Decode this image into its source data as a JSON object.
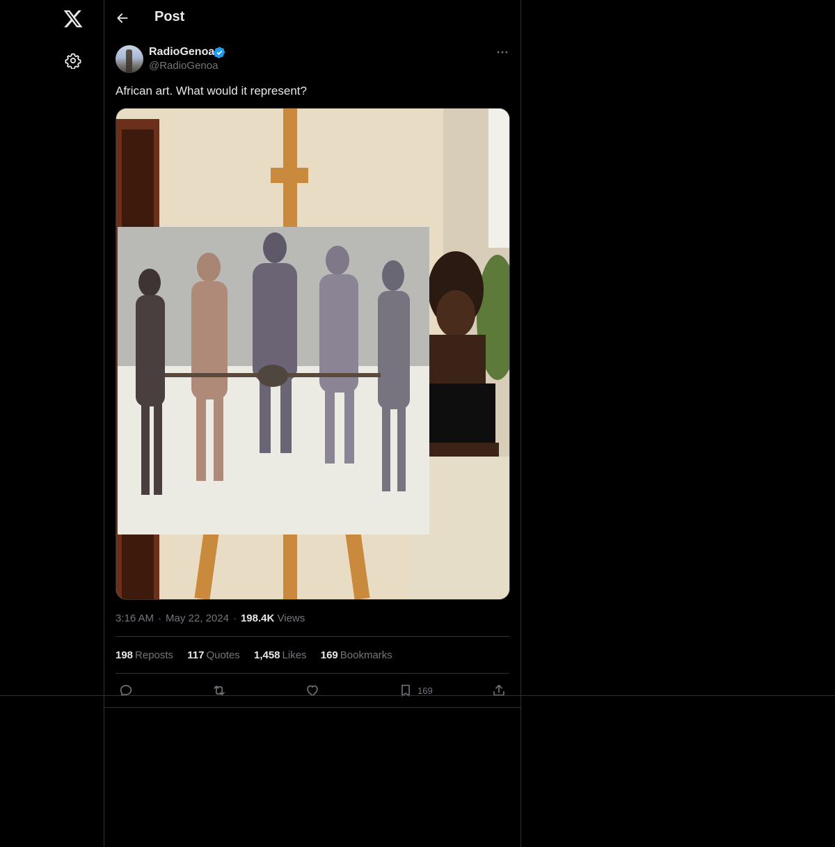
{
  "nav": {
    "logo_icon": "x-logo-icon",
    "settings_icon": "gear-icon"
  },
  "header": {
    "title": "Post"
  },
  "post": {
    "author": {
      "display_name": "RadioGenoa",
      "handle": "@RadioGenoa",
      "verified": true
    },
    "text": "African art. What would it represent?",
    "time": "3:16 AM",
    "date": "May 22, 2024",
    "views_count": "198.4K",
    "views_label": "Views",
    "stats": {
      "reposts_count": "198",
      "reposts_label": "Reposts",
      "quotes_count": "117",
      "quotes_label": "Quotes",
      "likes_count": "1,458",
      "likes_label": "Likes",
      "bookmarks_count": "169",
      "bookmarks_label": "Bookmarks"
    },
    "actions": {
      "bookmark_count": "169"
    }
  },
  "colors": {
    "background": "#000000",
    "border": "#2f3336",
    "text_primary": "#e7e9ea",
    "text_secondary": "#71767b",
    "verified_blue": "#1d9bf0"
  }
}
